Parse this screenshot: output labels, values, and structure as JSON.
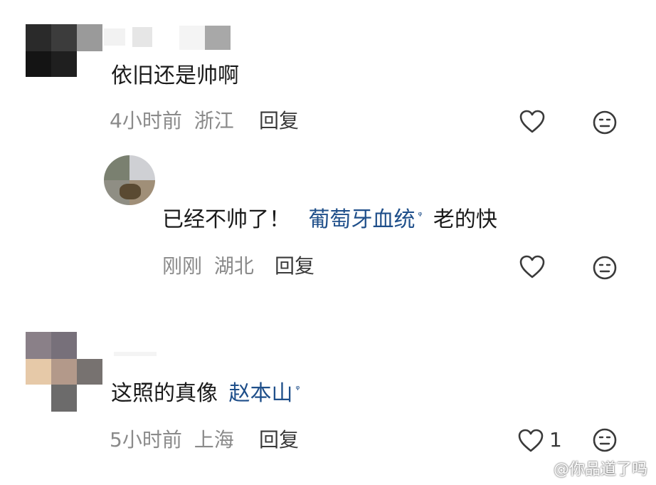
{
  "comments": [
    {
      "text": "依旧还是帅啊",
      "time": "4小时前",
      "location": "浙江",
      "reply_label": "回复",
      "like_count": ""
    },
    {
      "text_prefix": "已经不帅了！",
      "mention": "葡萄牙血统",
      "text_suffix": "老的快",
      "time": "刚刚",
      "location": "湖北",
      "reply_label": "回复",
      "like_count": ""
    },
    {
      "text_prefix": "这照的真像",
      "mention": "赵本山",
      "time": "5小时前",
      "location": "上海",
      "reply_label": "回复",
      "like_count": "1"
    }
  ],
  "search_mark": "ᵠ",
  "watermark": "@你品道了吗",
  "icons": {
    "like": "heart-outline-icon",
    "dislike": "neutral-face-icon",
    "search": "search-small-icon"
  },
  "colors": {
    "mention": "#1f4f8a",
    "meta": "#8a8a8a",
    "text": "#1a1a1a"
  }
}
